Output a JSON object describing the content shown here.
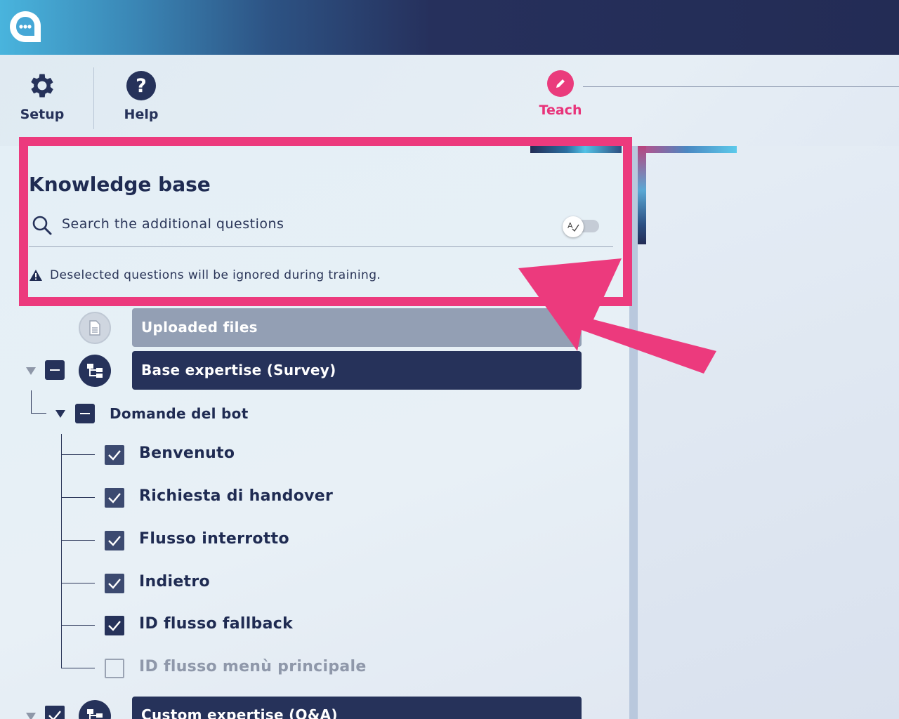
{
  "header": {
    "logo_icon": "chat-bubble-icon",
    "colors": {
      "gradient_start": "#49b4dd",
      "gradient_end": "#232c55"
    }
  },
  "toolbar": {
    "setup_label": "Setup",
    "help_label": "Help",
    "teach_label": "Teach"
  },
  "knowledge_base": {
    "title": "Knowledge base",
    "search_placeholder": "Search the additional questions",
    "toggle_state": "off",
    "warning": "Deselected questions will be ignored during training."
  },
  "tree": {
    "uploaded_files": "Uploaded files",
    "base_expertise": "Base expertise (Survey)",
    "section": "Domande del bot",
    "questions": [
      {
        "label": "Benvenuto",
        "checked": true
      },
      {
        "label": "Richiesta di handover",
        "checked": true
      },
      {
        "label": "Flusso interrotto",
        "checked": true
      },
      {
        "label": "Indietro",
        "checked": true
      },
      {
        "label": "ID flusso fallback",
        "checked": true
      },
      {
        "label": "ID flusso menù principale",
        "checked": false
      }
    ],
    "custom_expertise": "Custom expertise (Q&A)"
  },
  "colors": {
    "accent": "#ea3b7c",
    "navy": "#26325a"
  }
}
